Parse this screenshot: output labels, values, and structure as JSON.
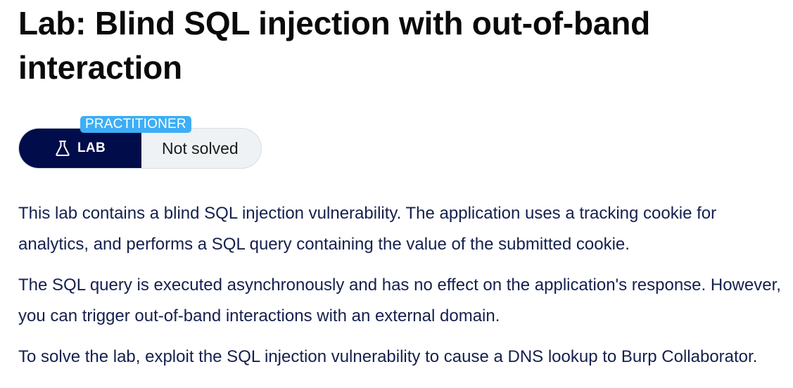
{
  "lab": {
    "title": "Lab: Blind SQL injection with out-of-band interaction",
    "level": "PRACTITIONER",
    "badge_label": "LAB",
    "badge_icon": "flask-icon",
    "status": "Not solved",
    "description": [
      "This lab contains a blind SQL injection vulnerability. The application uses a tracking cookie for analytics, and performs a SQL query containing the value of the submitted cookie.",
      "The SQL query is executed asynchronously and has no effect on the application's response. However, you can trigger out-of-band interactions with an external domain.",
      "To solve the lab, exploit the SQL injection vulnerability to cause a DNS lookup to Burp Collaborator."
    ]
  },
  "colors": {
    "badge_bg": "#010c4a",
    "level_tag_bg": "#3daef6",
    "status_bg": "#eef2f4",
    "title_text": "#0a0a0a",
    "body_text": "#15204e"
  }
}
